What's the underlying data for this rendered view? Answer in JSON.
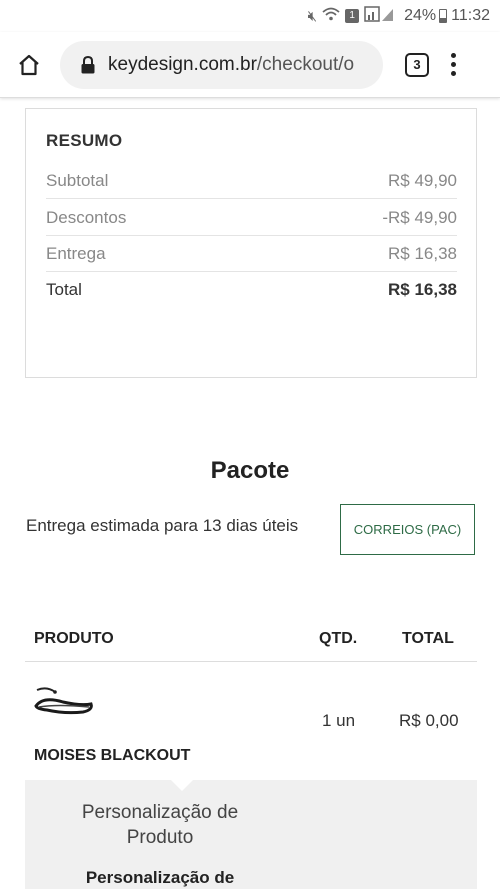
{
  "status_bar": {
    "battery": "24%",
    "time": "11:32",
    "sim_badge": "1",
    "icons": [
      "mute-icon",
      "wifi-icon",
      "sim-icon",
      "signal-icon",
      "battery-icon"
    ]
  },
  "browser": {
    "url_domain": "keydesign.com.br",
    "url_path": "/checkout/o",
    "tab_count": "3",
    "icons": [
      "home-icon",
      "lock-icon",
      "tabs-icon",
      "overflow-menu-icon"
    ]
  },
  "summary": {
    "title": "RESUMO",
    "rows": [
      {
        "label": "Subtotal",
        "value": "R$ 49,90"
      },
      {
        "label": "Descontos",
        "value": "-R$ 49,90"
      },
      {
        "label": "Entrega",
        "value": "R$ 16,38"
      },
      {
        "label": "Total",
        "value": "R$ 16,38"
      }
    ]
  },
  "package": {
    "title": "Pacote",
    "estimate": "Entrega estimada para 13 dias úteis",
    "shipping_method": "CORREIOS (PAC)"
  },
  "table": {
    "headers": [
      "PRODUTO",
      "QTD.",
      "TOTAL"
    ],
    "items": [
      {
        "name": "MOISES BLACKOUT",
        "quantity": "1 un",
        "total": "R$ 0,00"
      }
    ]
  },
  "personalization": {
    "heading_line1": "Personalização de",
    "heading_line2": "Produto",
    "subheading": "Personalização de"
  },
  "colors": {
    "accent": "#2e6b46",
    "border": "#dcdcdc",
    "muted_text": "#888888"
  }
}
